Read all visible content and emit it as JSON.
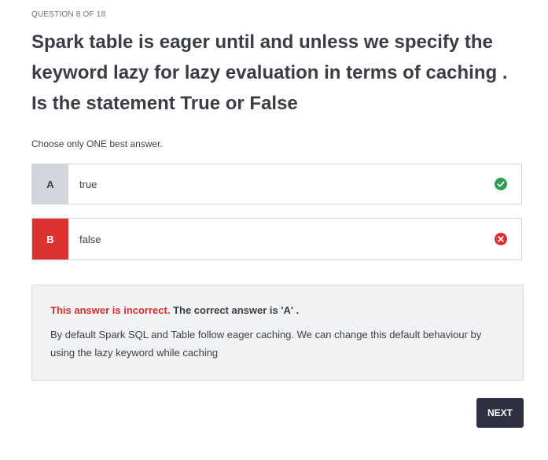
{
  "question": {
    "counter": "QUESTION 8 OF 18",
    "text": "Spark table is eager until and unless we specify the keyword lazy for lazy evaluation in terms of caching . Is the statement True or False",
    "instruction": "Choose only ONE best answer."
  },
  "options": [
    {
      "letter": "A",
      "text": "true",
      "status": "correct",
      "icon": "check-circle-icon",
      "letter_bg": "#d2d5dd"
    },
    {
      "letter": "B",
      "text": "false",
      "status": "selected-incorrect",
      "icon": "x-circle-icon",
      "letter_bg": "#dd3232"
    }
  ],
  "feedback": {
    "incorrect_label": "This answer is incorrect.",
    "correct_answer_label": "The correct answer is 'A' .",
    "explanation": "By default Spark SQL and Table follow eager caching. We can change this default behaviour by using the lazy keyword while caching"
  },
  "actions": {
    "next_label": "NEXT"
  },
  "colors": {
    "correct": "#2e9e4f",
    "incorrect": "#dd3232",
    "button_bg": "#2d3142"
  }
}
